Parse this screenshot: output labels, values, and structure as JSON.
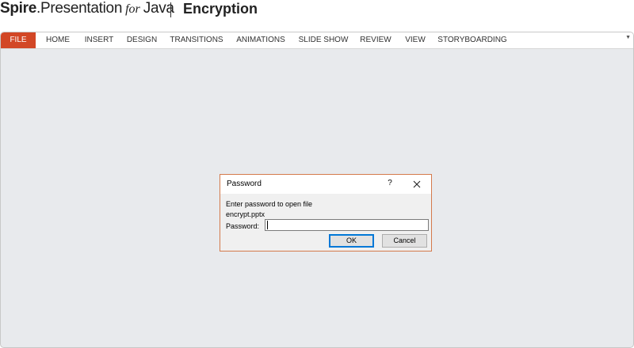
{
  "header": {
    "brand_spire": "Spire",
    "brand_product": ".Presentation",
    "brand_for": "for",
    "brand_java": "Java",
    "title": "Encryption"
  },
  "ribbon": {
    "tabs": [
      {
        "label": "FILE",
        "active": true
      },
      {
        "label": "HOME"
      },
      {
        "label": "INSERT"
      },
      {
        "label": "DESIGN"
      },
      {
        "label": "TRANSITIONS"
      },
      {
        "label": "ANIMATIONS"
      },
      {
        "label": "SLIDE SHOW"
      },
      {
        "label": "REVIEW"
      },
      {
        "label": "VIEW"
      },
      {
        "label": "STORYBOARDING"
      }
    ],
    "collapse_icon": "chevron-down-icon",
    "file_tab_color": "#d24726"
  },
  "dialog": {
    "title": "Password",
    "help_label": "?",
    "close_icon": "close-icon",
    "message_line1": "Enter password to open file",
    "message_line2": "encrypt.pptx",
    "password_label": "Password:",
    "password_value": "",
    "ok_label": "OK",
    "cancel_label": "Cancel",
    "border_color": "#d47a4c"
  }
}
